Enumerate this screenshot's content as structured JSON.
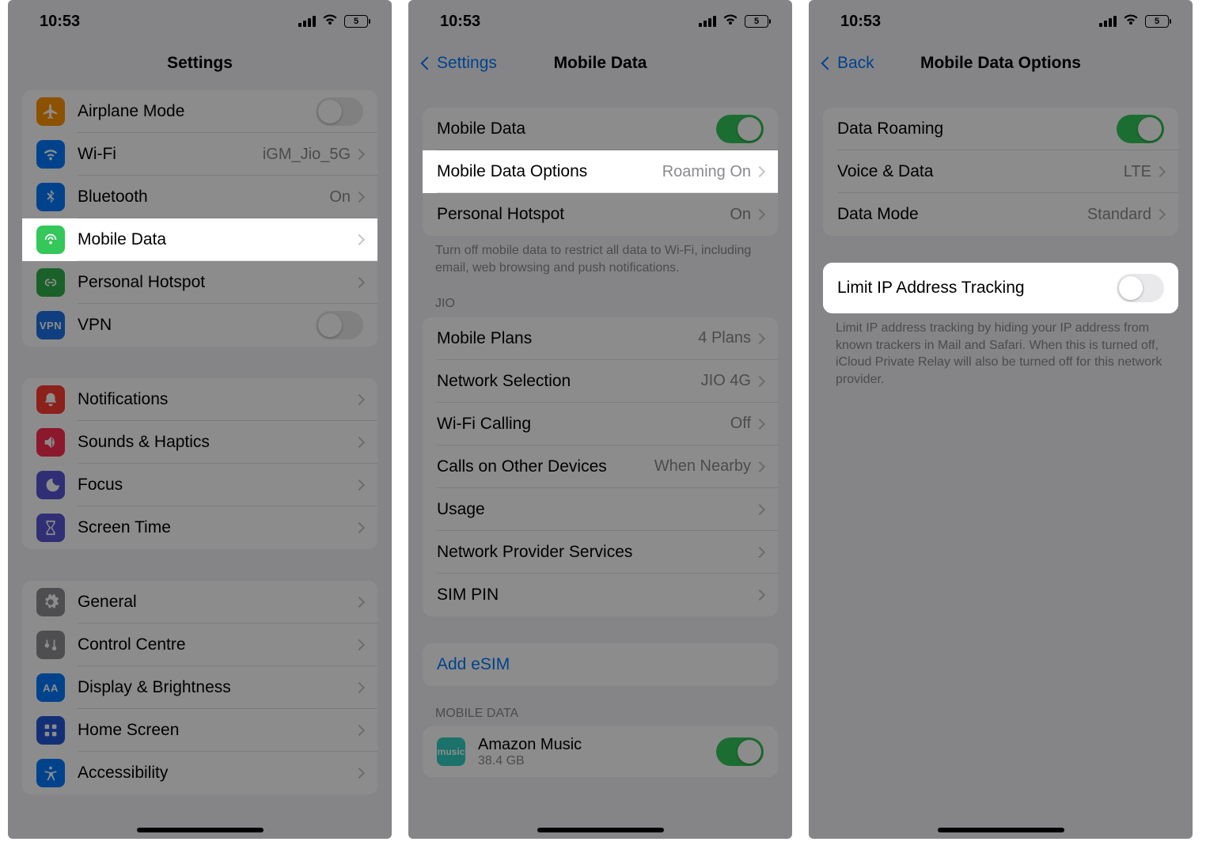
{
  "status": {
    "time": "10:53",
    "battery": "5"
  },
  "screen1": {
    "title": "Settings",
    "rows": {
      "airplane": "Airplane Mode",
      "wifi": {
        "label": "Wi-Fi",
        "detail": "iGM_Jio_5G"
      },
      "bluetooth": {
        "label": "Bluetooth",
        "detail": "On"
      },
      "mobiledata": "Mobile Data",
      "hotspot": "Personal Hotspot",
      "vpn": "VPN",
      "notifications": "Notifications",
      "sounds": "Sounds & Haptics",
      "focus": "Focus",
      "screentime": "Screen Time",
      "general": "General",
      "control": "Control Centre",
      "display": "Display & Brightness",
      "home": "Home Screen",
      "accessibility": "Accessibility"
    }
  },
  "screen2": {
    "back": "Settings",
    "title": "Mobile Data",
    "rows": {
      "mobiledata": "Mobile Data",
      "options": {
        "label": "Mobile Data Options",
        "detail": "Roaming On"
      },
      "hotspot": {
        "label": "Personal Hotspot",
        "detail": "On"
      }
    },
    "footer1": "Turn off mobile data to restrict all data to Wi-Fi, including email, web browsing and push notifications.",
    "header_jio": "JIO",
    "jio": {
      "plans": {
        "label": "Mobile Plans",
        "detail": "4 Plans"
      },
      "network": {
        "label": "Network Selection",
        "detail": "JIO 4G"
      },
      "wificall": {
        "label": "Wi-Fi Calling",
        "detail": "Off"
      },
      "calls": {
        "label": "Calls on Other Devices",
        "detail": "When Nearby"
      },
      "usage": "Usage",
      "provider": "Network Provider Services",
      "simpin": "SIM PIN"
    },
    "addesim": "Add eSIM",
    "header_md": "MOBILE DATA",
    "app": {
      "name": "Amazon Music",
      "detail": "38.4 GB"
    }
  },
  "screen3": {
    "back": "Back",
    "title": "Mobile Data Options",
    "rows": {
      "roaming": "Data Roaming",
      "voice": {
        "label": "Voice & Data",
        "detail": "LTE"
      },
      "mode": {
        "label": "Data Mode",
        "detail": "Standard"
      },
      "limitip": "Limit IP Address Tracking"
    },
    "footer": "Limit IP address tracking by hiding your IP address from known trackers in Mail and Safari. When this is turned off, iCloud Private Relay will also be turned off for this network provider."
  }
}
